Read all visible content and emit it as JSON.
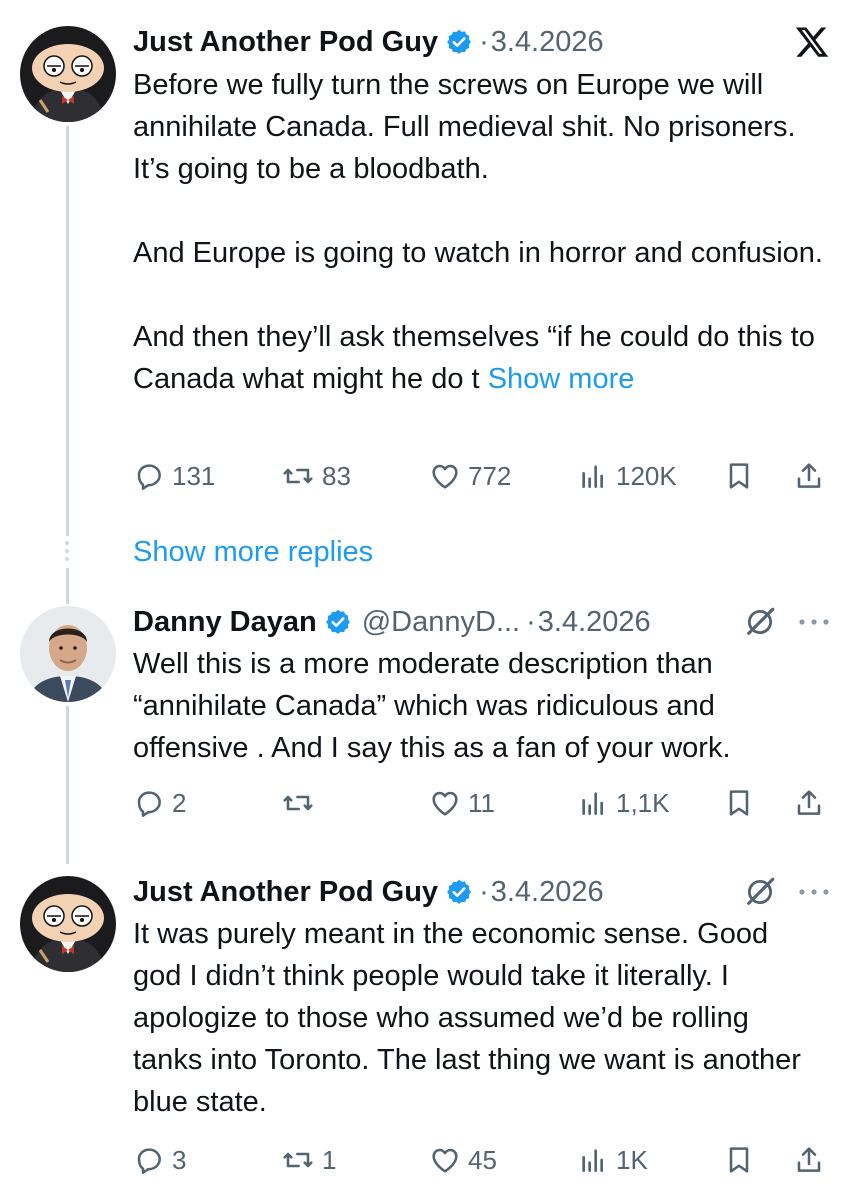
{
  "tweets": [
    {
      "name": "Just Another Pod Guy",
      "handle": "",
      "date": "3.4.2026",
      "header_icon": "x-logo-icon",
      "paragraphs": [
        "Before we fully turn the screws on Europe we will annihilate Canada.  Full medieval shit. No prisoners. It’s going to be a bloodbath.",
        "And Europe is going to watch in horror and confusion.",
        "And then they’ll ask themselves “if he could do this to Canada what might he do t"
      ],
      "show_more": "Show more",
      "replies": "131",
      "reposts": "83",
      "likes": "772",
      "views": "120K"
    },
    {
      "name": "Danny Dayan",
      "handle": "@DannyD...",
      "date": "3.4.2026",
      "header_icon": "grok-icon",
      "text": "Well this is a more moderate description than “annihilate Canada” which was ridiculous and offensive . And I say this as a fan of your work.",
      "replies": "2",
      "reposts": "",
      "likes": "11",
      "views": "1,1K"
    },
    {
      "name": "Just Another Pod Guy",
      "handle": "",
      "date": "3.4.2026",
      "header_icon": "grok-icon",
      "text": "It was purely meant in the economic sense. Good god I didn’t think people would take it literally.  I apologize to those who assumed we’d be rolling tanks into Toronto.  The last thing we want is another blue state.",
      "replies": "3",
      "reposts": "1",
      "likes": "45",
      "views": "1K"
    }
  ],
  "show_more_replies": "Show more replies",
  "colors": {
    "accent": "#1d9bf0",
    "muted": "#536471",
    "text": "#0f1419",
    "thread_line": "#cfd9de"
  }
}
